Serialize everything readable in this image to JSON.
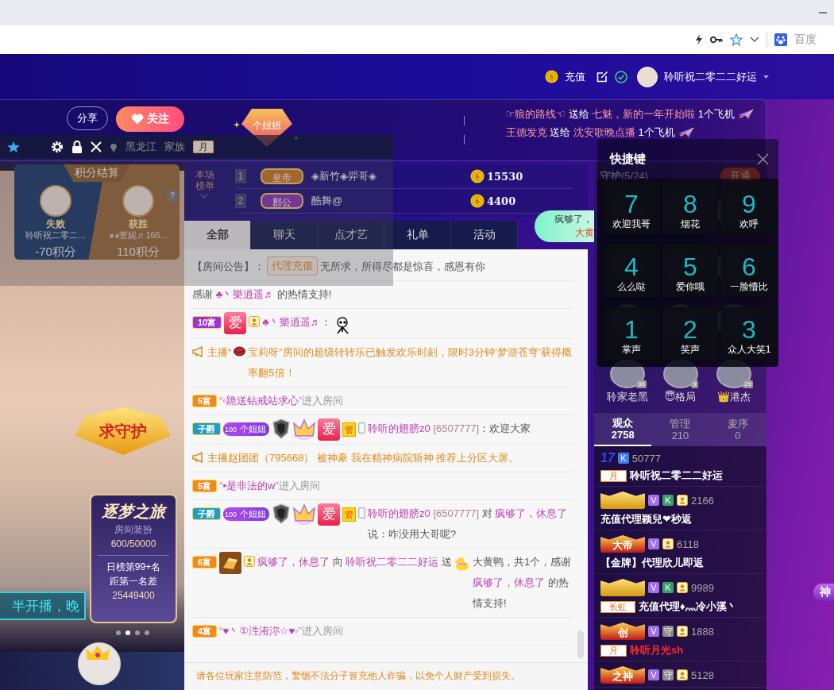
{
  "browser": {
    "search_engine": "百度"
  },
  "header": {
    "recharge": "充值",
    "username": "聆听祝二零二二好运"
  },
  "room": {
    "share": "分享",
    "follow": "关注",
    "badge": "个妞妞"
  },
  "gift_ticker": [
    {
      "sender": "☞狼的路线☜",
      "verb": "送给",
      "receiver": "七魅，新的一年开始啦",
      "gift": "1个飞机"
    },
    {
      "sender": "王德发克",
      "verb": "送给",
      "receiver": "沈安歌晚点播",
      "gift": "1个飞机"
    }
  ],
  "toolbar": {
    "location": "黑龙江",
    "family_label": "家族",
    "family_tag": "月"
  },
  "score_card": {
    "title": "积分结算",
    "help": "?",
    "sides": [
      {
        "result": "失败",
        "name": "聆听祝二零二...",
        "score": "-70积分"
      },
      {
        "result": "获胜",
        "name": "◕◕萱妮♬166...",
        "score": "110积分"
      }
    ]
  },
  "guard_banner": "求守护",
  "video_caption": "半开播，晚",
  "dream_card": {
    "title": "逐梦之旅",
    "label": "房间装扮",
    "progress": "600/50000",
    "rank": "日榜第99+名",
    "gap_label": "距第一名差",
    "gap": "25449400"
  },
  "carousel": [
    {
      "selected": false
    },
    {
      "selected": true
    },
    {
      "selected": false
    },
    {
      "selected": false
    }
  ],
  "ranking": {
    "title_top": "本场",
    "title_bottom": "榜单",
    "rows": [
      {
        "rank": "1",
        "title": "皇帝",
        "name": "◈新竹◈羿哥◈",
        "coins": "15530"
      },
      {
        "rank": "2",
        "title": "郡公",
        "name": "酷舞@",
        "coins": "4400"
      }
    ]
  },
  "tabs": [
    {
      "label": "全部",
      "selected": true
    },
    {
      "label": "聊天",
      "selected": false
    },
    {
      "label": "点才艺",
      "selected": false
    },
    {
      "label": "礼单",
      "selected": false
    },
    {
      "label": "活动",
      "selected": false
    }
  ],
  "bubble": {
    "line1": "疯够了，",
    "line2": "大黄"
  },
  "chat": {
    "notice": {
      "label": "【房间公告】：",
      "tag": "代理充值",
      "text": "无所求，所得尽都是惊喜，感恩有你"
    },
    "messages": [
      {
        "kind": "thanks",
        "parts": [
          {
            "kind": "plain",
            "text": "感谢 "
          },
          {
            "kind": "name",
            "text": "♣丶樂逍遥♬"
          },
          {
            "kind": "plain",
            "text": " 的热情支持!"
          }
        ]
      },
      {
        "kind": "chat",
        "badges": [
          {
            "kind": "level",
            "text": "10富",
            "color": "#a230d8"
          },
          {
            "kind": "love",
            "text": "爱"
          },
          {
            "kind": "host"
          }
        ],
        "parts": [
          {
            "kind": "name",
            "text": "♣丶樂逍遥♬"
          },
          {
            "kind": "plain",
            "text": "："
          },
          {
            "kind": "skeleton"
          }
        ]
      },
      {
        "kind": "system",
        "parts": [
          {
            "kind": "system",
            "text": "主播“"
          },
          {
            "kind": "lips"
          },
          {
            "kind": "system",
            "text": "宝莉呀”房间的超级转转乐已触发欢乐时刻，限时3分钟‘梦游苍穹’获得概率翻5倍！"
          }
        ]
      },
      {
        "kind": "enter",
        "badges": [
          {
            "kind": "level",
            "text": "5富",
            "color": "#f08a1e"
          }
        ],
        "parts": [
          {
            "kind": "system",
            "text": "“"
          },
          {
            "kind": "name",
            "text": "◦跪送钻戒站求心"
          },
          {
            "kind": "muted",
            "text": "”进入房间"
          }
        ]
      },
      {
        "kind": "chat",
        "badges": [
          {
            "kind": "level",
            "text": "子爵",
            "color": "#1d9fc4"
          },
          {
            "kind": "fan",
            "level": "100",
            "text": "个妞妞"
          },
          {
            "kind": "guard"
          },
          {
            "kind": "crown"
          },
          {
            "kind": "love",
            "text": "爱"
          },
          {
            "kind": "admin",
            "text": "管"
          },
          {
            "kind": "phone"
          }
        ],
        "parts": [
          {
            "kind": "name",
            "text": "聆听的翅膀z0"
          },
          {
            "kind": "id",
            "text": " [6507777]"
          },
          {
            "kind": "plain",
            "text": "：欢迎大家"
          }
        ]
      },
      {
        "kind": "system",
        "parts": [
          {
            "kind": "system",
            "text": "主播赵团团（795668） 被神豪 我在精神病院斩神 推荐上分区大屏。"
          }
        ]
      },
      {
        "kind": "enter",
        "badges": [
          {
            "kind": "level",
            "text": "5富",
            "color": "#f08a1e"
          }
        ],
        "parts": [
          {
            "kind": "system",
            "text": "“"
          },
          {
            "kind": "name",
            "text": "▪是非法的w"
          },
          {
            "kind": "muted",
            "text": "”进入房间"
          }
        ]
      },
      {
        "kind": "chat",
        "badges": [
          {
            "kind": "level",
            "text": "子爵",
            "color": "#1d9fc4"
          },
          {
            "kind": "fan",
            "level": "100",
            "text": "个妞妞"
          },
          {
            "kind": "guard"
          },
          {
            "kind": "crown"
          },
          {
            "kind": "love",
            "text": "爱"
          },
          {
            "kind": "admin",
            "text": "管"
          },
          {
            "kind": "phone"
          }
        ],
        "parts": [
          {
            "kind": "name",
            "text": "聆听的翅膀z0"
          },
          {
            "kind": "id",
            "text": " [6507777]"
          },
          {
            "kind": "plain",
            "text": " 对 "
          },
          {
            "kind": "name",
            "text": "疯够了，休息了"
          },
          {
            "kind": "plain",
            "text": " 说：咋没用大哥呢?"
          }
        ]
      },
      {
        "kind": "gift",
        "badges": [
          {
            "kind": "level",
            "text": "6富",
            "color": "#f08a1e"
          },
          {
            "kind": "gold"
          },
          {
            "kind": "host"
          }
        ],
        "parts": [
          {
            "kind": "name",
            "text": "疯够了，休息了"
          },
          {
            "kind": "plain",
            "text": " 向 "
          },
          {
            "kind": "name",
            "text": "聆听祝二零二二好运"
          },
          {
            "kind": "plain",
            "text": " 送 "
          },
          {
            "kind": "duck"
          },
          {
            "kind": "plain",
            "text": " 大黄鸭，共1个，感谢 "
          },
          {
            "kind": "name",
            "text": "疯够了，休息了"
          },
          {
            "kind": "plain",
            "text": " 的热情支持!"
          }
        ]
      },
      {
        "kind": "enter",
        "badges": [
          {
            "kind": "level",
            "text": "4富",
            "color": "#f08a1e"
          }
        ],
        "parts": [
          {
            "kind": "system",
            "text": "“"
          },
          {
            "kind": "name",
            "text": "♥丶①泩洧沵☆♥◦"
          },
          {
            "kind": "muted",
            "text": "”进入房间"
          }
        ]
      }
    ],
    "warning": "请各位玩家注意防范，警惕不法分子冒充他人诈骗，以免个人财产受到损失。"
  },
  "guard": {
    "title": "守护",
    "count": "(5/24)",
    "open": "开通",
    "members": [
      {
        "name": "聆家老黑",
        "level": "36"
      },
      {
        "name": "😇格局",
        "level": "9"
      },
      {
        "name": "👑港杰",
        "level": "29"
      }
    ]
  },
  "shortcuts": {
    "title": "快捷键",
    "keys": [
      {
        "key": "7",
        "label": "欢迎我哥"
      },
      {
        "key": "8",
        "label": "烟花"
      },
      {
        "key": "9",
        "label": "欢呼"
      },
      {
        "key": "4",
        "label": "么么哒"
      },
      {
        "key": "5",
        "label": "爱你哦"
      },
      {
        "key": "6",
        "label": "一脸懵比"
      },
      {
        "key": "1",
        "label": "掌声"
      },
      {
        "key": "2",
        "label": "笑声"
      },
      {
        "key": "3",
        "label": "众人大笑1"
      }
    ]
  },
  "audience_tabs": [
    {
      "label": "观众",
      "count": "2758",
      "selected": true
    },
    {
      "label": "管理",
      "count": "210",
      "selected": false
    },
    {
      "label": "麦序",
      "count": "0",
      "selected": false
    }
  ],
  "audience": [
    {
      "rank": {
        "kind": "level",
        "text": "17"
      },
      "badges": [
        {
          "kind": "letter",
          "text": "K",
          "color": "#3f7ef0"
        }
      ],
      "number": "50777",
      "tag": "月",
      "name": "聆听祝二零二二好运",
      "highlighted": false
    },
    {
      "rank": {
        "kind": "plaque"
      },
      "badges": [
        {
          "kind": "letter",
          "text": "V",
          "color": "#a070e8"
        },
        {
          "kind": "letter",
          "text": "K",
          "color": "#33a36a"
        },
        {
          "kind": "host"
        }
      ],
      "number": "2166",
      "name": "充值代理颖兒❤秒返",
      "highlighted": false
    },
    {
      "rank": {
        "kind": "crown",
        "text": "大帝"
      },
      "badges": [
        {
          "kind": "letter",
          "text": "V",
          "color": "#a070e8"
        },
        {
          "kind": "host"
        }
      ],
      "number": "6118",
      "name": "【金牌】代理欣儿即返",
      "highlighted": false
    },
    {
      "rank": {
        "kind": "plaque"
      },
      "badges": [
        {
          "kind": "letter",
          "text": "V",
          "color": "#a070e8"
        },
        {
          "kind": "letter",
          "text": "K",
          "color": "#33a36a"
        },
        {
          "kind": "host"
        }
      ],
      "number": "9989",
      "tag": "长虹",
      "name": "充值代理♦灬冷小溪丶",
      "highlighted": false
    },
    {
      "rank": {
        "kind": "crown",
        "text": "创"
      },
      "badges": [
        {
          "kind": "letter",
          "text": "V",
          "color": "#a070e8"
        },
        {
          "kind": "letter",
          "text": "守",
          "color": "#8a8a8a"
        },
        {
          "kind": "host"
        }
      ],
      "number": "1888",
      "tag": "月",
      "name": "聆听月光sh",
      "highlighted": true
    },
    {
      "rank": {
        "kind": "crown",
        "text": "之神"
      },
      "badges": [
        {
          "kind": "letter",
          "text": "V",
          "color": "#a070e8"
        },
        {
          "kind": "letter",
          "text": "守",
          "color": "#8a8a8a"
        },
        {
          "kind": "host"
        }
      ],
      "number": "5128"
    }
  ],
  "side_badge": "神"
}
